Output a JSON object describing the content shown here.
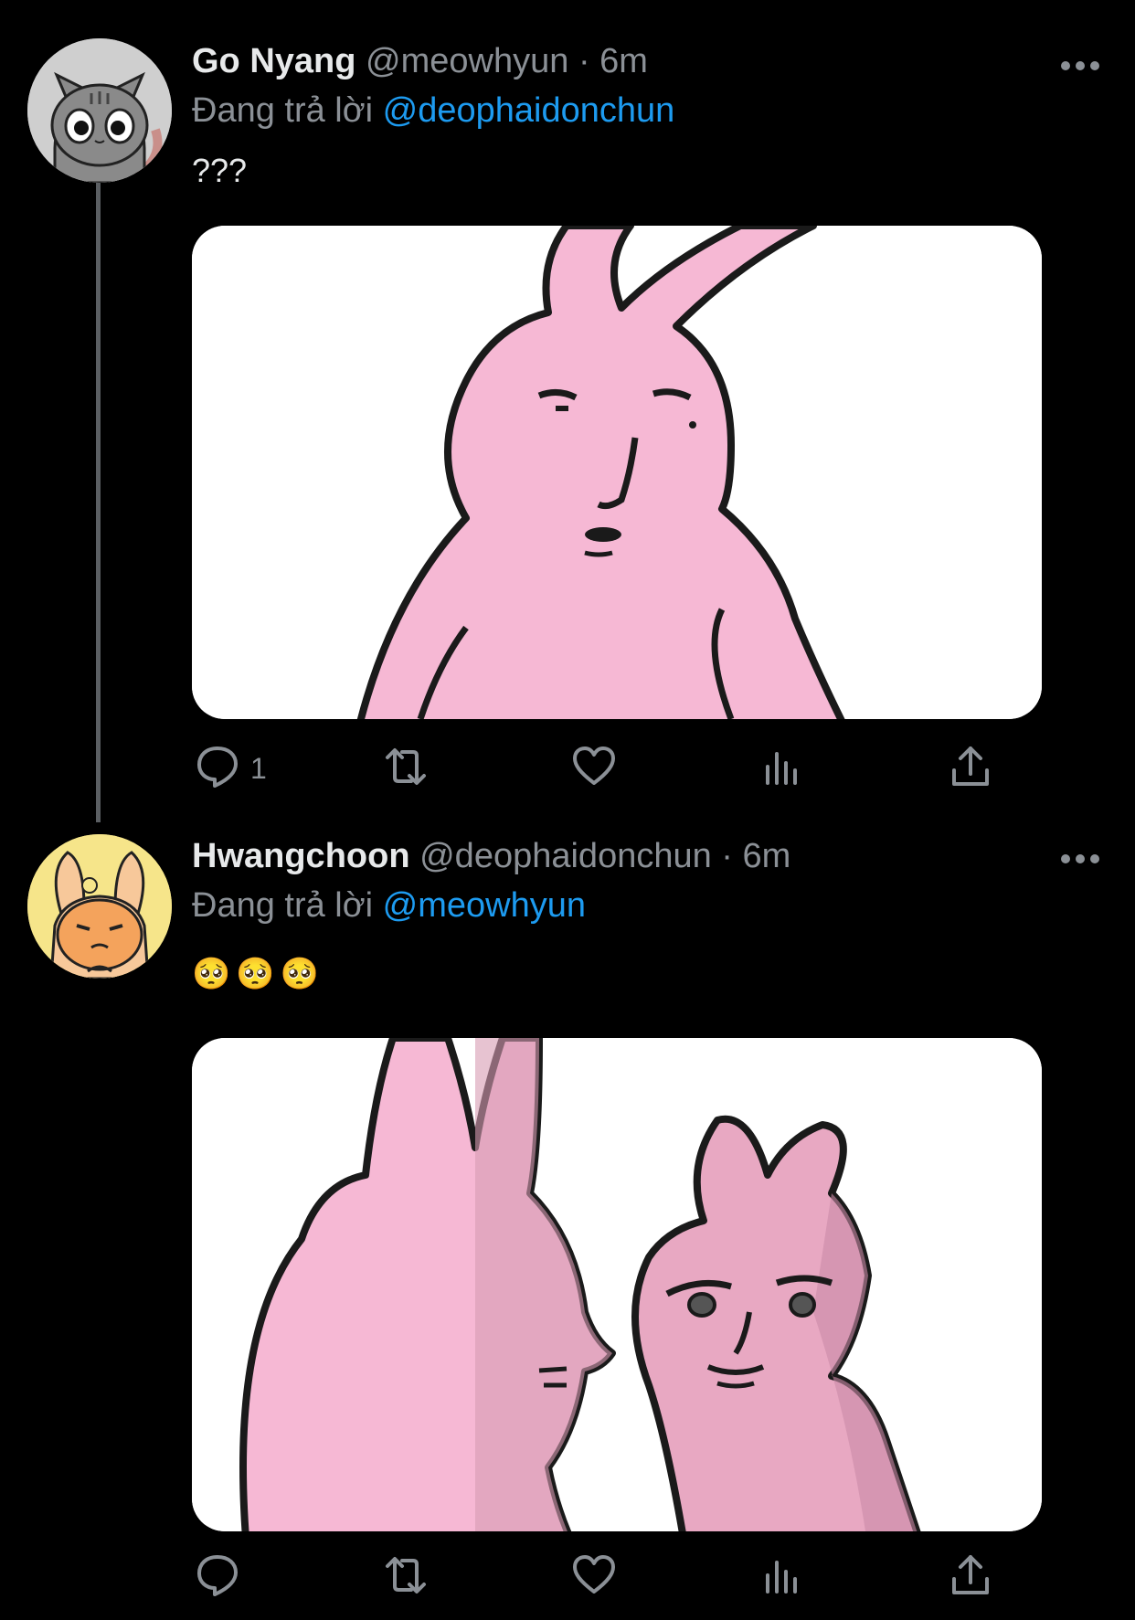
{
  "tweets": [
    {
      "name": "Go Nyang",
      "handle": "@meowhyun",
      "time": "· 6m",
      "replying_prefix": "Đang trả lời",
      "replying_to": "@deophaidonchun",
      "text": "???",
      "reply_count": "1",
      "avatar_icon": "cat-avatar",
      "media_icon": "pink-bunny-image"
    },
    {
      "name": "Hwangchoon",
      "handle": "@deophaidonchun",
      "time": "· 6m",
      "replying_prefix": "Đang trả lời",
      "replying_to": "@meowhyun",
      "text": "🥺🥺🥺",
      "reply_count": "",
      "avatar_icon": "bunny-avatar",
      "media_icon": "two-bunnies-image"
    }
  ],
  "icons": {
    "reply": "reply-icon",
    "retweet": "retweet-icon",
    "like": "heart-icon",
    "views": "views-icon",
    "share": "share-icon",
    "more": "more-icon"
  },
  "colors": {
    "background": "#000000",
    "mention": "#1d9bf0",
    "muted": "#8b9096",
    "bunny_pink": "#f6b8d4"
  }
}
